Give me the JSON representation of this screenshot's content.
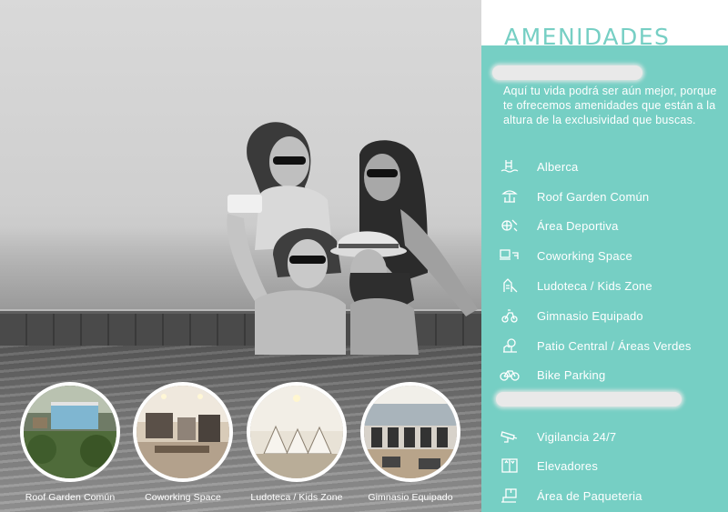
{
  "colors": {
    "accent": "#76cfc4",
    "text_on_accent": "#ffffff",
    "background": "#ffffff"
  },
  "panel": {
    "title": "AMENIDADES",
    "intro": "Aquí tu vida podrá ser aún mejor, porque te ofrecemos amenidades que están a la altura de la exclusividad que buscas.",
    "amenities": [
      {
        "label": "Alberca",
        "icon": "pool-icon"
      },
      {
        "label": "Roof Garden Común",
        "icon": "garden-icon"
      },
      {
        "label": "Área Deportiva",
        "icon": "sports-icon"
      },
      {
        "label": "Coworking Space",
        "icon": "coworking-icon"
      },
      {
        "label": "Ludoteca / Kids Zone",
        "icon": "kids-icon"
      },
      {
        "label": "Gimnasio Equipado",
        "icon": "gym-icon"
      },
      {
        "label": "Patio Central / Áreas Verdes",
        "icon": "patio-icon"
      },
      {
        "label": "Bike Parking",
        "icon": "bike-icon"
      }
    ],
    "services": [
      {
        "label": "Vigilancia 24/7",
        "icon": "security-camera-icon"
      },
      {
        "label": "Elevadores",
        "icon": "elevator-icon"
      },
      {
        "label": "Área de Paqueteria",
        "icon": "package-icon"
      }
    ]
  },
  "thumbnails": [
    {
      "label": "Roof Garden Común"
    },
    {
      "label": "Coworking Space"
    },
    {
      "label": "Ludoteca / Kids Zone"
    },
    {
      "label": "Gimnasio Equipado"
    }
  ]
}
